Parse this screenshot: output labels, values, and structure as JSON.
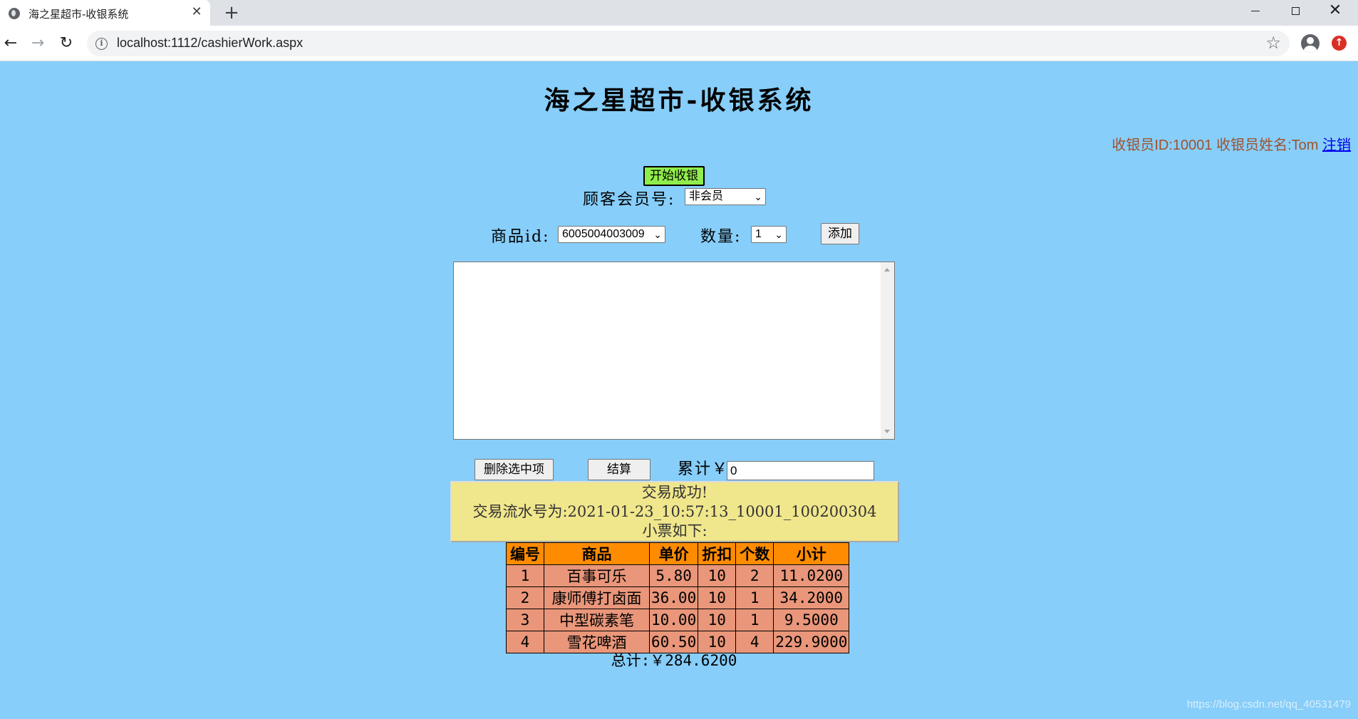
{
  "browser": {
    "tab_title": "海之星超市-收银系统",
    "tab_close": "✕",
    "new_tab": "+",
    "url": "localhost:1112/cashierWork.aspx"
  },
  "page": {
    "title": "海之星超市-收银系统",
    "cashier_info": "收银员ID:10001 收银员姓名:Tom",
    "logout": "注销"
  },
  "form": {
    "start_button": "开始收银",
    "member_label": "顾客会员号:",
    "member_selected": "非会员",
    "product_label": "商品id:",
    "product_selected": "6005004003009",
    "qty_label": "数量:",
    "qty_selected": "1",
    "add_button": "添加",
    "delete_button": "删除选中项",
    "checkout_button": "结算",
    "total_label": "累计￥",
    "total_value": "0"
  },
  "result": {
    "line1": "交易成功!",
    "line2": "交易流水号为:2021-01-23_10:57:13_10001_100200304",
    "line3": "小票如下:"
  },
  "receipt": {
    "headers": [
      "编号",
      "商品",
      "单价",
      "折扣",
      "个数",
      "小计"
    ],
    "rows": [
      [
        "1",
        "百事可乐",
        "5.80",
        "10",
        "2",
        "11.0200"
      ],
      [
        "2",
        "康师傅打卤面",
        "36.00",
        "10",
        "1",
        "34.2000"
      ],
      [
        "3",
        "中型碳素笔",
        "10.00",
        "10",
        "1",
        "9.5000"
      ],
      [
        "4",
        "雪花啤酒",
        "60.50",
        "10",
        "4",
        "229.9000"
      ]
    ],
    "grand_total": "总计:￥284.6200"
  },
  "watermark": "https://blog.csdn.net/qq_40531479",
  "colors": {
    "page_bg": "#87cefa",
    "start_button_bg": "#90ee4a",
    "result_bg": "#f0e68c",
    "table_header_bg": "#ff8c00",
    "table_cell_bg": "#e9967a",
    "cashier_info_color": "#a0522d"
  }
}
